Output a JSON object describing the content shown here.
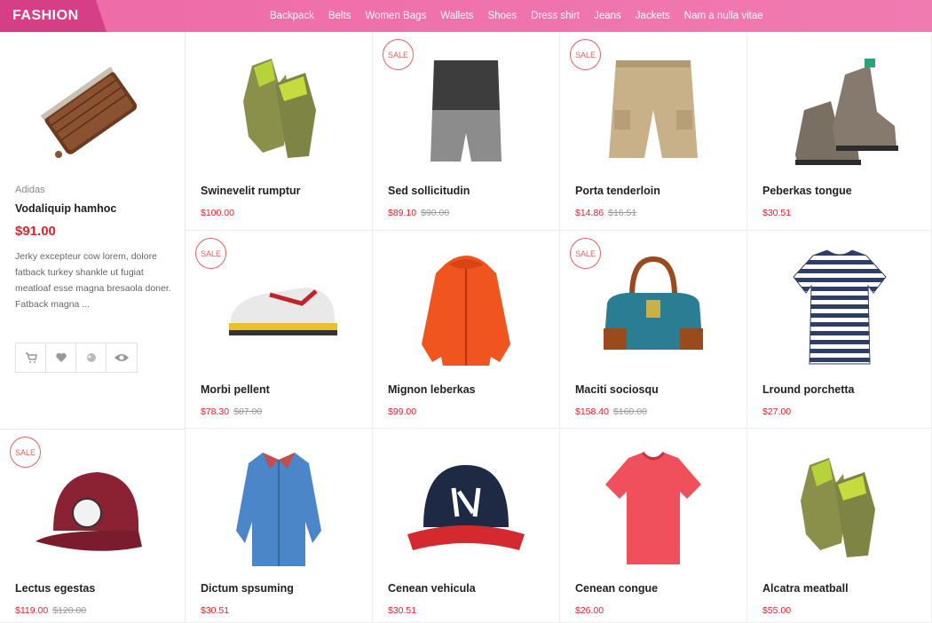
{
  "brand": "FASHION",
  "nav": [
    "Backpack",
    "Belts",
    "Women Bags",
    "Wallets",
    "Shoes",
    "Dress shirt",
    "Jeans",
    "Jackets",
    "Nam a nulla vitae"
  ],
  "sale_label": "SALE",
  "featured": {
    "brand": "Adidas",
    "title": "Vodaliquip hamhoc",
    "price": "$91.00",
    "description": " Jerky excepteur cow lorem, dolore fatback turkey shankle ut fugiat meatloaf esse magna bresaola doner. Fatback magna ..."
  },
  "products": [
    {
      "name": "Swinevelit rumptur",
      "price": "$100.00",
      "old": "",
      "sale": false,
      "icon": "gloves-icon"
    },
    {
      "name": "Sed sollicitudin",
      "price": "$89.10",
      "old": "$90.00",
      "sale": true,
      "icon": "shorts-icon"
    },
    {
      "name": "Porta tenderloin",
      "price": "$14.86",
      "old": "$16.51",
      "sale": true,
      "icon": "shorts-icon"
    },
    {
      "name": "Peberkas tongue",
      "price": "$30.51",
      "old": "",
      "sale": false,
      "icon": "boots-icon"
    },
    {
      "name": "Morbi pellent",
      "price": "$78.30",
      "old": "$87.00",
      "sale": true,
      "icon": "sneaker-icon"
    },
    {
      "name": "Mignon leberkas",
      "price": "$99.00",
      "old": "",
      "sale": false,
      "icon": "jacket-icon"
    },
    {
      "name": "Maciti sociosqu",
      "price": "$158.40",
      "old": "$160.00",
      "sale": true,
      "icon": "handbag-icon"
    },
    {
      "name": "Lround porchetta",
      "price": "$27.00",
      "old": "",
      "sale": false,
      "icon": "tshirt-icon"
    },
    {
      "name": "Lectus egestas",
      "price": "$119.00",
      "old": "$120.00",
      "sale": true,
      "icon": "cap-icon"
    },
    {
      "name": "Dictum spsuming",
      "price": "$30.51",
      "old": "",
      "sale": false,
      "icon": "shirt-icon"
    },
    {
      "name": "Cenean vehicula",
      "price": "$30.51",
      "old": "",
      "sale": false,
      "icon": "cap-icon"
    },
    {
      "name": "Cenean congue",
      "price": "$26.00",
      "old": "",
      "sale": false,
      "icon": "tshirt-icon"
    },
    {
      "name": "Alcatra meatball",
      "price": "$55.00",
      "old": "",
      "sale": false,
      "icon": "gloves-icon"
    }
  ],
  "colors": {
    "accent": "#ee6aa7",
    "brand_bg": "#d63f86",
    "price": "#e0222c",
    "sale": "#e56060"
  }
}
